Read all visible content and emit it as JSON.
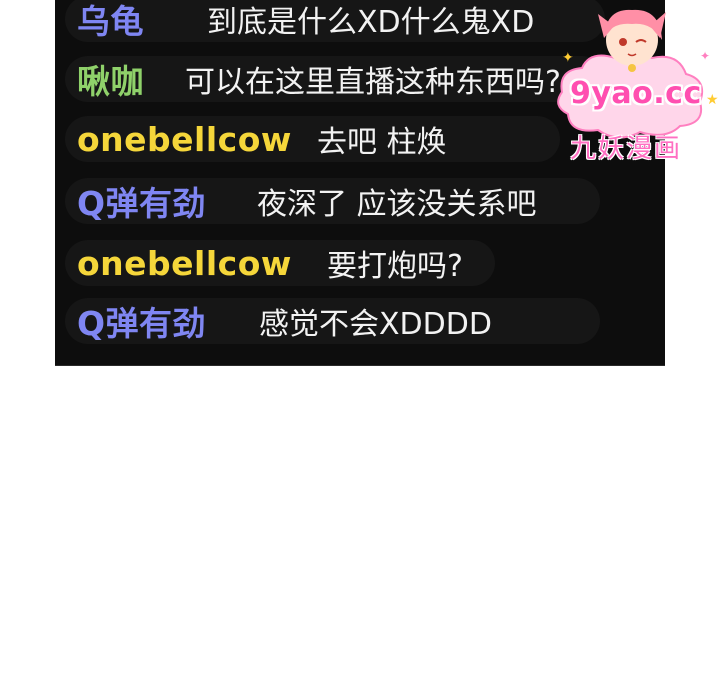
{
  "colors": {
    "panel_bg": "#0d0d0d",
    "row_bg": "#161616",
    "message_text": "#f2f2f2",
    "watermark_pink": "#ff4fb0"
  },
  "chat": {
    "messages": [
      {
        "user": "乌龟",
        "text": "到底是什么XD什么鬼XD",
        "user_color": "#7f86f2"
      },
      {
        "user": "啾咖",
        "text": "可以在这里直播这种东西吗?",
        "user_color": "#8fd16a"
      },
      {
        "user": "onebellcow",
        "text": "去吧 柱焕",
        "user_color": "#f5d63a"
      },
      {
        "user": "Q弹有劲",
        "text": "夜深了 应该没关系吧",
        "user_color": "#7f86f2"
      },
      {
        "user": "onebellcow",
        "text": "要打炮吗?",
        "user_color": "#f5d63a"
      },
      {
        "user": "Q弹有劲",
        "text": "感觉不会XDDDD",
        "user_color": "#7f86f2"
      }
    ]
  },
  "watermark": {
    "site": "9yao.cc",
    "name": "九妖漫画",
    "icon": "anime-girl-mascot-icon"
  }
}
